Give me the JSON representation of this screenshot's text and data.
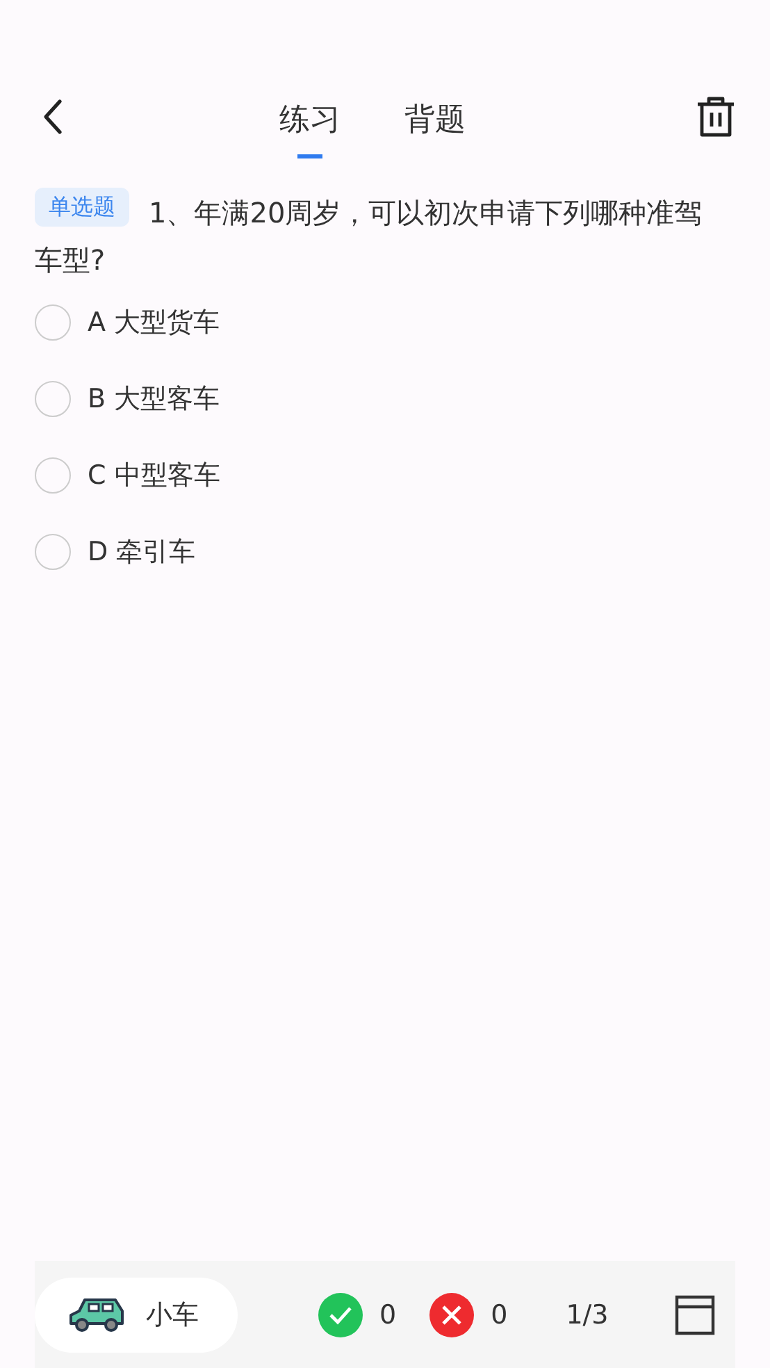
{
  "tabs": [
    {
      "label": "练习",
      "selected": true
    },
    {
      "label": "背题",
      "selected": false
    }
  ],
  "question": {
    "type_tag": "单选题",
    "text": "1、年满20周岁，可以初次申请下列哪种准驾车型?"
  },
  "options": [
    {
      "label": "A 大型货车",
      "selected": false
    },
    {
      "label": "B 大型客车",
      "selected": false
    },
    {
      "label": "C 中型客车",
      "selected": false
    },
    {
      "label": "D 牵引车",
      "selected": false
    }
  ],
  "bottom_bar": {
    "vehicle": "小车",
    "correct_count": "0",
    "wrong_count": "0",
    "progress": "1/3"
  }
}
